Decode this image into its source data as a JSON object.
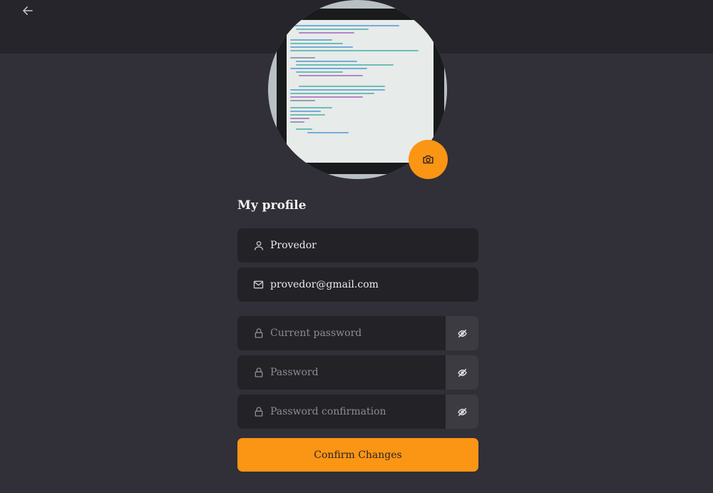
{
  "header": {
    "back_icon": "arrow-left-icon"
  },
  "avatar": {
    "alt": "profile picture",
    "camera_icon": "camera-icon",
    "accent": "#fb9514"
  },
  "profile": {
    "title": "My profile",
    "name": {
      "icon": "user-icon",
      "value": "Provedor"
    },
    "email": {
      "icon": "mail-icon",
      "value": "provedor@gmail.com"
    }
  },
  "passwords": [
    {
      "icon": "lock-icon",
      "placeholder": "Current password",
      "toggle_icon": "eye-off-icon"
    },
    {
      "icon": "lock-icon",
      "placeholder": "Password",
      "toggle_icon": "eye-off-icon"
    },
    {
      "icon": "lock-icon",
      "placeholder": "Password confirmation",
      "toggle_icon": "eye-off-icon"
    }
  ],
  "actions": {
    "confirm_label": "Confirm Changes"
  },
  "colors": {
    "background": "#312f37",
    "header": "#26252b",
    "field": "#232227",
    "accent": "#fb9514"
  }
}
